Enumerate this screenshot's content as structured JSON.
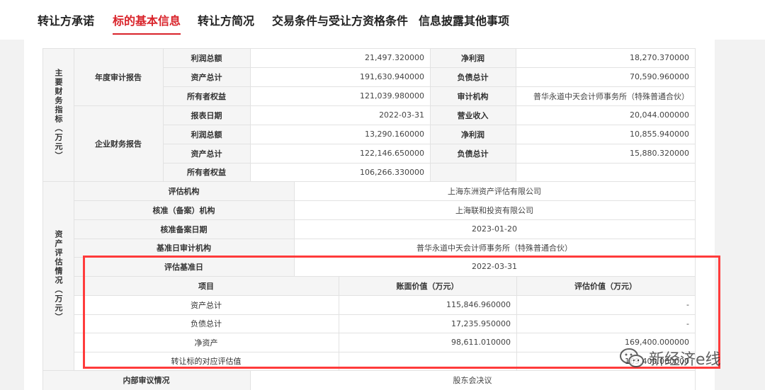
{
  "tabs": [
    "转让方承诺",
    "标的基本信息",
    "转让方简况",
    "交易条件与受让方资格条件",
    "信息披露其他事项"
  ],
  "active_tab": "标的基本信息",
  "financial": {
    "section_label": "主要财务指标（万元）",
    "annual_audit": {
      "label": "年度审计报告",
      "rows": [
        [
          "利润总额",
          "21,497.320000",
          "净利润",
          "18,270.370000"
        ],
        [
          "资产总计",
          "191,630.940000",
          "负债总计",
          "70,590.960000"
        ],
        [
          "所有者权益",
          "121,039.980000",
          "审计机构",
          "普华永道中天会计师事务所（特殊普通合伙）"
        ]
      ]
    },
    "enterprise_report": {
      "label": "企业财务报告",
      "rows": [
        [
          "报表日期",
          "2022-03-31",
          "营业收入",
          "20,044.000000"
        ],
        [
          "利润总额",
          "13,290.160000",
          "净利润",
          "10,855.940000"
        ],
        [
          "资产总计",
          "122,146.650000",
          "负债总计",
          "15,880.320000"
        ],
        [
          "所有者权益",
          "106,266.330000",
          "",
          ""
        ]
      ]
    }
  },
  "valuation": {
    "section_label": "资产评估情况（万元）",
    "info_rows": [
      [
        "评估机构",
        "上海东洲资产评估有限公司"
      ],
      [
        "核准（备案）机构",
        "上海联和投资有限公司"
      ],
      [
        "核准备案日期",
        "2023-01-20"
      ],
      [
        "基准日审计机构",
        "普华永道中天会计师事务所（特殊普通合伙）"
      ],
      [
        "评估基准日",
        "2022-03-31"
      ]
    ],
    "table_headers": [
      "项目",
      "账面价值（万元）",
      "评估价值（万元）"
    ],
    "table_rows": [
      [
        "资产总计",
        "115,846.960000",
        "-"
      ],
      [
        "负债总计",
        "17,235.950000",
        "-"
      ],
      [
        "净资产",
        "98,611.010000",
        "169,400.000000"
      ],
      [
        "转让标的对应评估值",
        "",
        "169,400.000000"
      ]
    ]
  },
  "internal_review": {
    "label": "内部审议情况",
    "value": "股东会决议"
  },
  "watermark": {
    "text": "新经济e线"
  }
}
